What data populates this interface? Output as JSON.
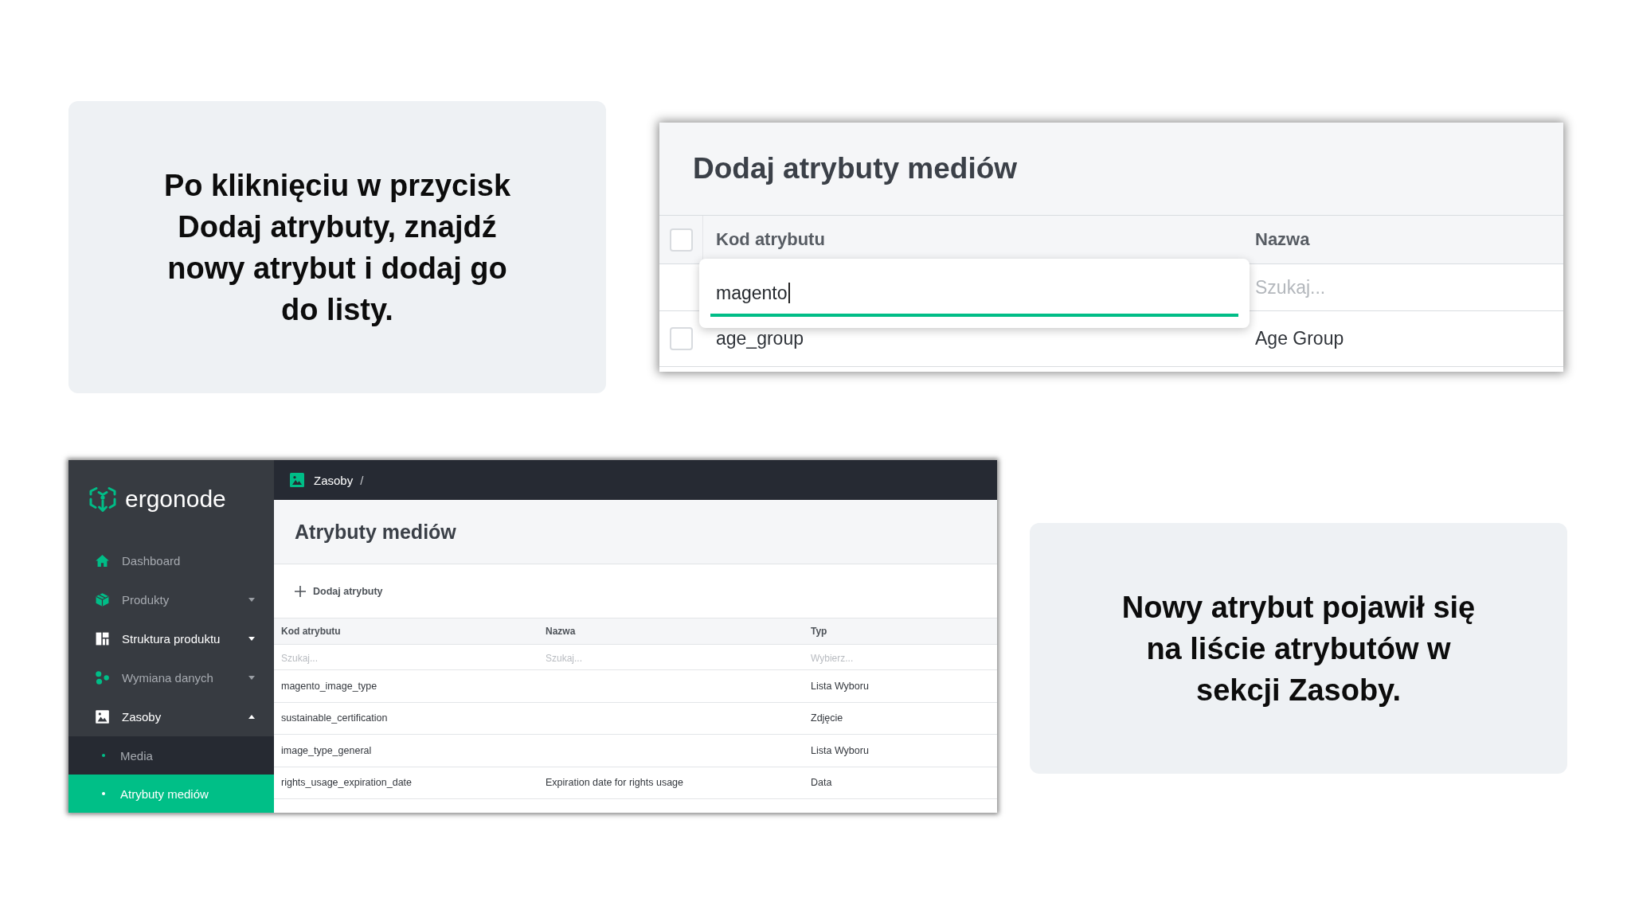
{
  "callouts": [
    {
      "text": "Po kliknięciu w przycisk Dodaj atrybuty, znajdź nowy atrybut i dodaj go do listy."
    },
    {
      "text": "Nowy atrybut pojawił się na liście atrybutów w sekcji Zasoby."
    }
  ],
  "dialog": {
    "title": "Dodaj atrybuty mediów",
    "select_all": {
      "checked": false
    },
    "columns": [
      "Kod atrybutu",
      "Nazwa"
    ],
    "code_search": {
      "value": "magento",
      "focused": true
    },
    "name_search": {
      "placeholder": "Szukaj..."
    },
    "rows": [
      {
        "checked": false,
        "code": "age_group",
        "name": "Age Group"
      }
    ]
  },
  "app": {
    "logo": "ergonode",
    "sidebar": {
      "items": [
        {
          "kind": "link",
          "label": "Dashboard",
          "highlighted": false
        },
        {
          "kind": "group",
          "label": "Produkty",
          "highlighted": false,
          "expanded": false
        },
        {
          "kind": "group",
          "label": "Struktura produktu",
          "highlighted": true,
          "expanded": false
        },
        {
          "kind": "group",
          "label": "Wymiana danych",
          "highlighted": false,
          "expanded": false
        },
        {
          "kind": "group",
          "label": "Zasoby",
          "highlighted": true,
          "expanded": true,
          "children": [
            {
              "label": "Media",
              "selected": false
            },
            {
              "label": "Atrybuty mediów",
              "selected": true
            }
          ]
        }
      ]
    },
    "breadcrumb": {
      "label": "Zasoby",
      "separator": "/"
    },
    "page_title": "Atrybuty mediów",
    "add_button": "Dodaj atrybuty",
    "table": {
      "columns": [
        "Kod atrybutu",
        "Nazwa",
        "Typ"
      ],
      "filters": [
        {
          "placeholder": "Szukaj..."
        },
        {
          "placeholder": "Szukaj..."
        },
        {
          "placeholder": "Wybierz..."
        }
      ],
      "rows": [
        {
          "code": "magento_image_type",
          "type": "Lista Wyboru"
        },
        {
          "code": "sustainable_certification",
          "type": "Zdjęcie"
        },
        {
          "code": "image_type_general",
          "type": "Lista Wyboru"
        },
        {
          "code": "rights_usage_expiration_date",
          "name": "Expiration date for rights usage",
          "type": "Data"
        }
      ]
    }
  }
}
